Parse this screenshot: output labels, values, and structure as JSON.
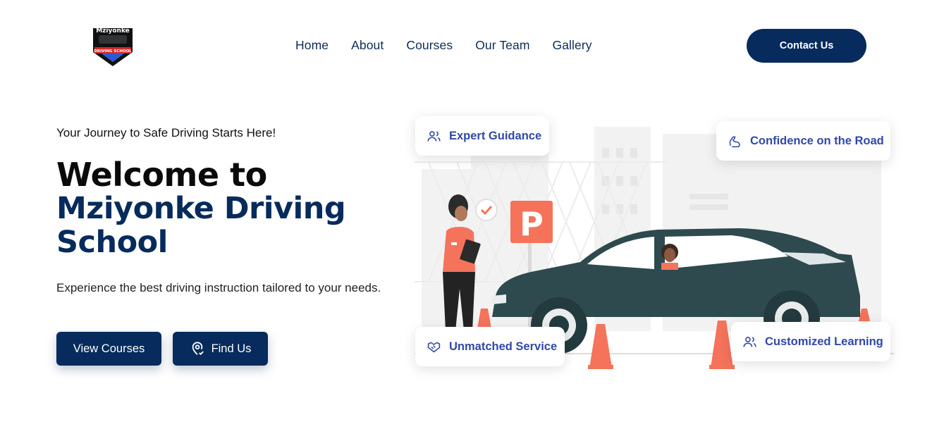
{
  "logo": {
    "text_top": "Mziyonke",
    "text_bottom": "DRIVING SCHOOL"
  },
  "nav": {
    "items": [
      {
        "label": "Home"
      },
      {
        "label": "About"
      },
      {
        "label": "Courses"
      },
      {
        "label": "Our Team"
      },
      {
        "label": "Gallery"
      }
    ],
    "contact_label": "Contact Us"
  },
  "hero": {
    "tagline": "Your Journey to Safe Driving Starts Here!",
    "title_line1": "Welcome to",
    "title_line2": "Mziyonke Driving",
    "title_line3": "School",
    "subtitle": "Experience the best driving instruction tailored to your needs.",
    "primary_button": "View Courses",
    "secondary_button": "Find Us"
  },
  "features": {
    "expert": {
      "label": "Expert Guidance",
      "icon": "users-icon"
    },
    "confidence": {
      "label": "Confidence on the Road",
      "icon": "muscle-arm-icon"
    },
    "service": {
      "label": "Unmatched Service",
      "icon": "handshake-icon"
    },
    "learning": {
      "label": "Customized Learning",
      "icon": "users-icon"
    }
  },
  "illustration": {
    "parking_sign": "P"
  },
  "colors": {
    "primary": "#062b5c",
    "accent_text": "#3048a8",
    "car": "#2e4a4f",
    "coral": "#f4735a"
  }
}
